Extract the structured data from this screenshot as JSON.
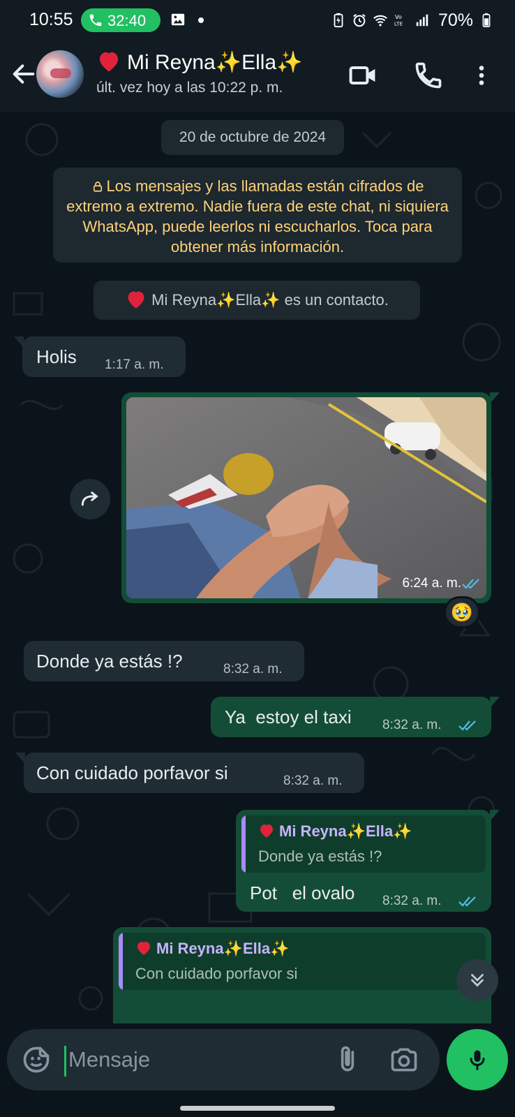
{
  "status_bar": {
    "time": "10:55",
    "call_duration": "32:40",
    "battery": "70%",
    "icons": [
      "phone-icon",
      "image-icon",
      "battery-saver-icon",
      "alarm-icon",
      "wifi-icon",
      "volte-icon",
      "signal-icon",
      "battery-icon"
    ]
  },
  "header": {
    "contact_name": "Mi Reyna✨Ella✨",
    "last_seen": "últ. vez hoy a las 10:22 p. m.",
    "icons": [
      "back-arrow-icon",
      "video-call-icon",
      "phone-icon",
      "more-vert-icon"
    ]
  },
  "chat": {
    "date_chip": "20 de octubre de 2024",
    "encryption_notice": "Los mensajes y las llamadas están cifrados de extremo a extremo. Nadie fuera de este chat, ni siquiera WhatsApp, puede leerlos ni escucharlos. Toca para obtener más información.",
    "contact_notice_name": "Mi Reyna✨Ella✨",
    "contact_notice_suffix": " es un contacto.",
    "messages": [
      {
        "direction": "in",
        "text": "Holis",
        "time": "1:17 a. m."
      },
      {
        "direction": "out",
        "type": "image",
        "time": "6:24 a. m.",
        "reaction": "🥹",
        "read": true
      },
      {
        "direction": "in",
        "text": "Donde ya estás !?",
        "time": "8:32 a. m."
      },
      {
        "direction": "out",
        "text": "Ya  estoy el taxi",
        "time": "8:32 a. m.",
        "read": true
      },
      {
        "direction": "in",
        "text": "Con cuidado porfavor si",
        "time": "8:32 a. m."
      },
      {
        "direction": "out",
        "reply_to_name": "Mi Reyna✨Ella✨",
        "reply_to_text": "Donde ya estás !?",
        "text": "Pot   el ovalo",
        "time": "8:32 a. m.",
        "read": true
      },
      {
        "direction": "out",
        "reply_to_name": "Mi Reyna✨Ella✨",
        "reply_to_text": "Con cuidado porfavor si"
      }
    ]
  },
  "input": {
    "placeholder": "Mensaje",
    "icons": [
      "sticker-icon",
      "attach-icon",
      "camera-icon",
      "mic-icon"
    ]
  },
  "colors": {
    "accent_green": "#21c063",
    "incoming_bubble": "#1f2c34",
    "outgoing_bubble": "#144d37",
    "read_ticks": "#53bdeb",
    "notice_text": "#ffd279",
    "quote_bar": "#a78bfa"
  }
}
